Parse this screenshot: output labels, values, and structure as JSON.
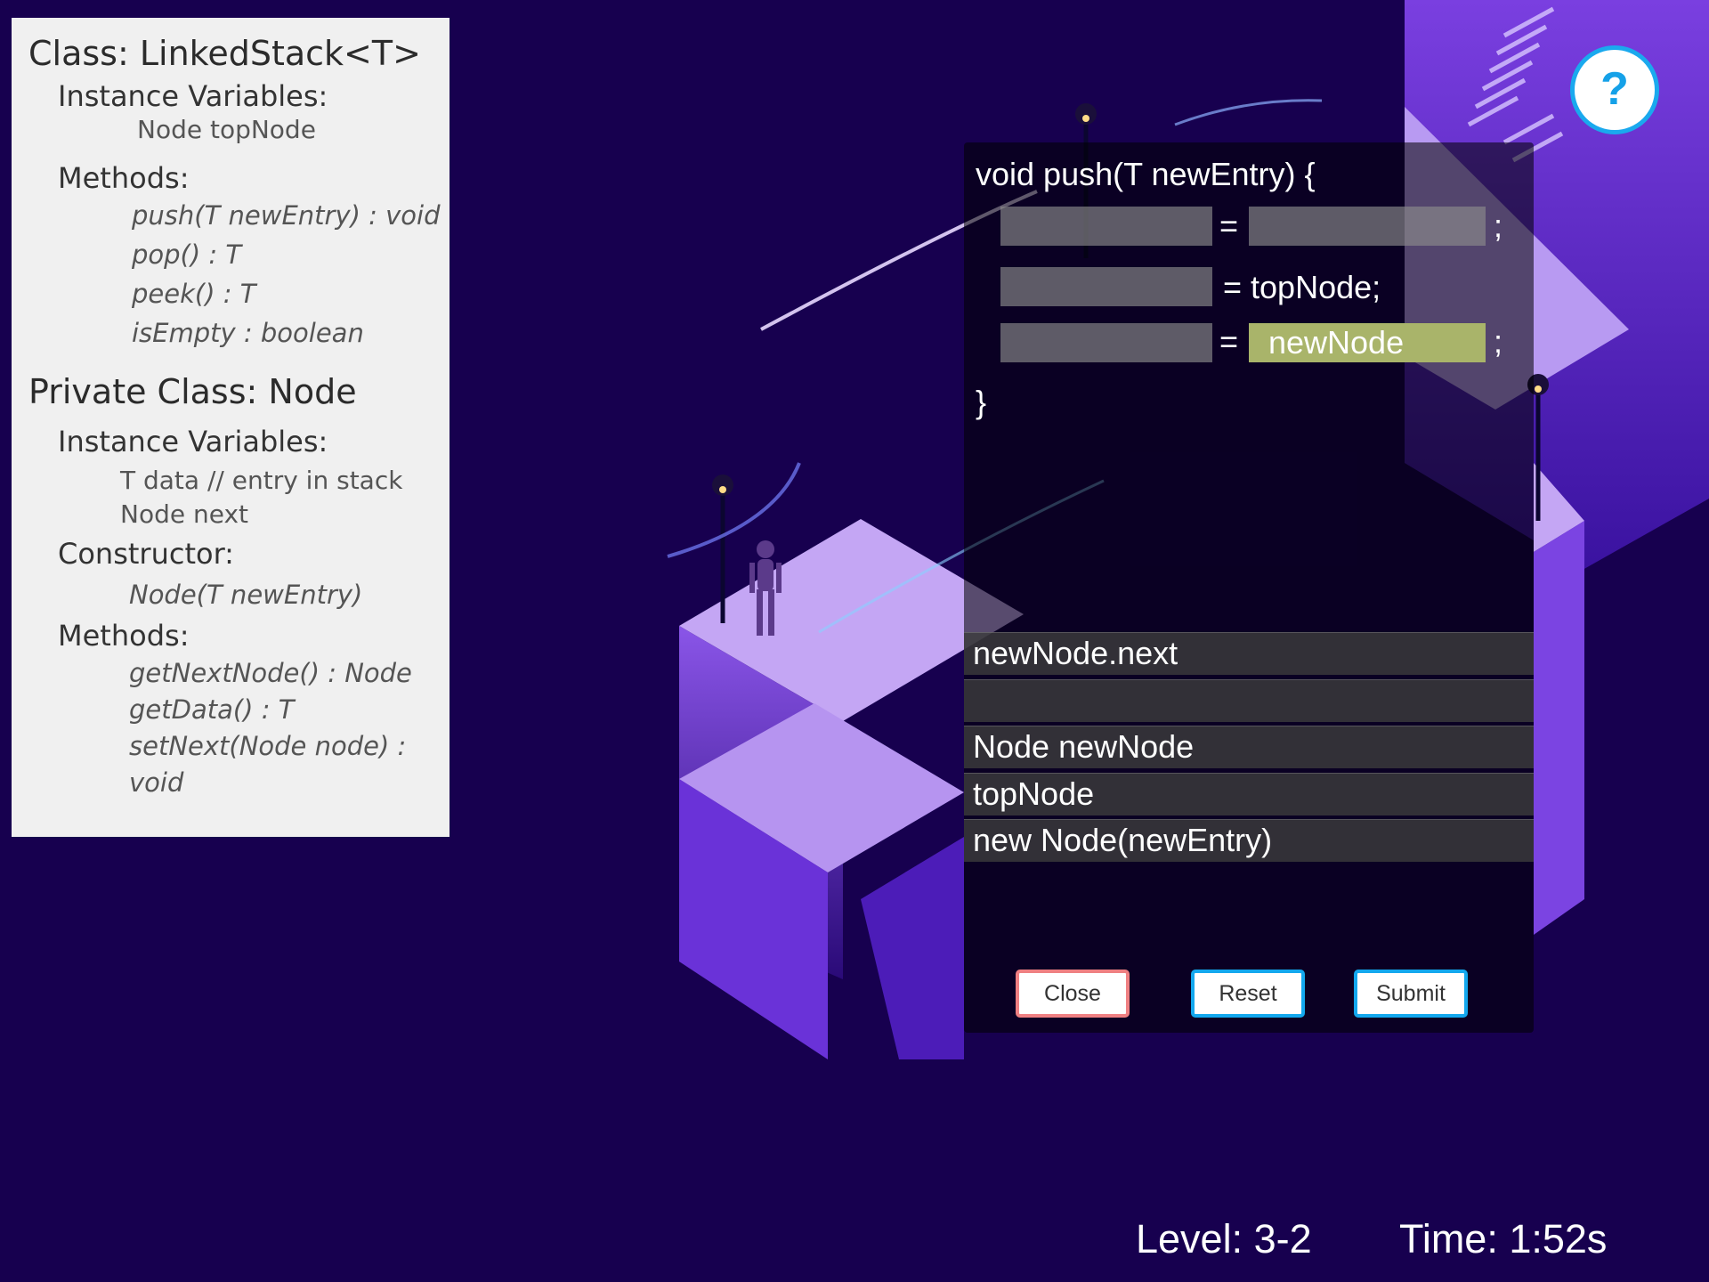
{
  "reference": {
    "class_title": "Class: LinkedStack<T>",
    "instance_vars_label": "Instance Variables:",
    "instance_vars": [
      "Node topNode"
    ],
    "methods_label": "Methods:",
    "methods": [
      "push(T newEntry) : void",
      "pop() : T",
      "peek() : T",
      "isEmpty : boolean"
    ],
    "private_class_title": "Private Class: Node",
    "node_instance_vars_label": "Instance Variables:",
    "node_instance_vars": [
      "T data // entry in stack",
      "Node next"
    ],
    "constructor_label": "Constructor:",
    "constructor": "Node(T newEntry)",
    "node_methods_label": "Methods:",
    "node_methods": [
      "getNextNode() : Node",
      "getData() : T",
      "setNext(Node node) : void"
    ]
  },
  "code": {
    "signature": "void push(T newEntry)  {",
    "equals": "=",
    "semicolon": ";",
    "line2_rhs": "= topNode;",
    "filled_slot": "newNode",
    "closing_brace": "}"
  },
  "options": [
    "newNode.next",
    "",
    "Node newNode",
    "topNode",
    "new Node(newEntry)"
  ],
  "buttons": {
    "close": "Close",
    "reset": "Reset",
    "submit": "Submit"
  },
  "help": "?",
  "hud": {
    "level": "Level: 3-2",
    "time": "Time: 1:52s"
  },
  "colors": {
    "background": "#17004f",
    "slot_filled": "#a9b46a",
    "close_border": "#ef8082",
    "accent_blue": "#13a8ee"
  }
}
